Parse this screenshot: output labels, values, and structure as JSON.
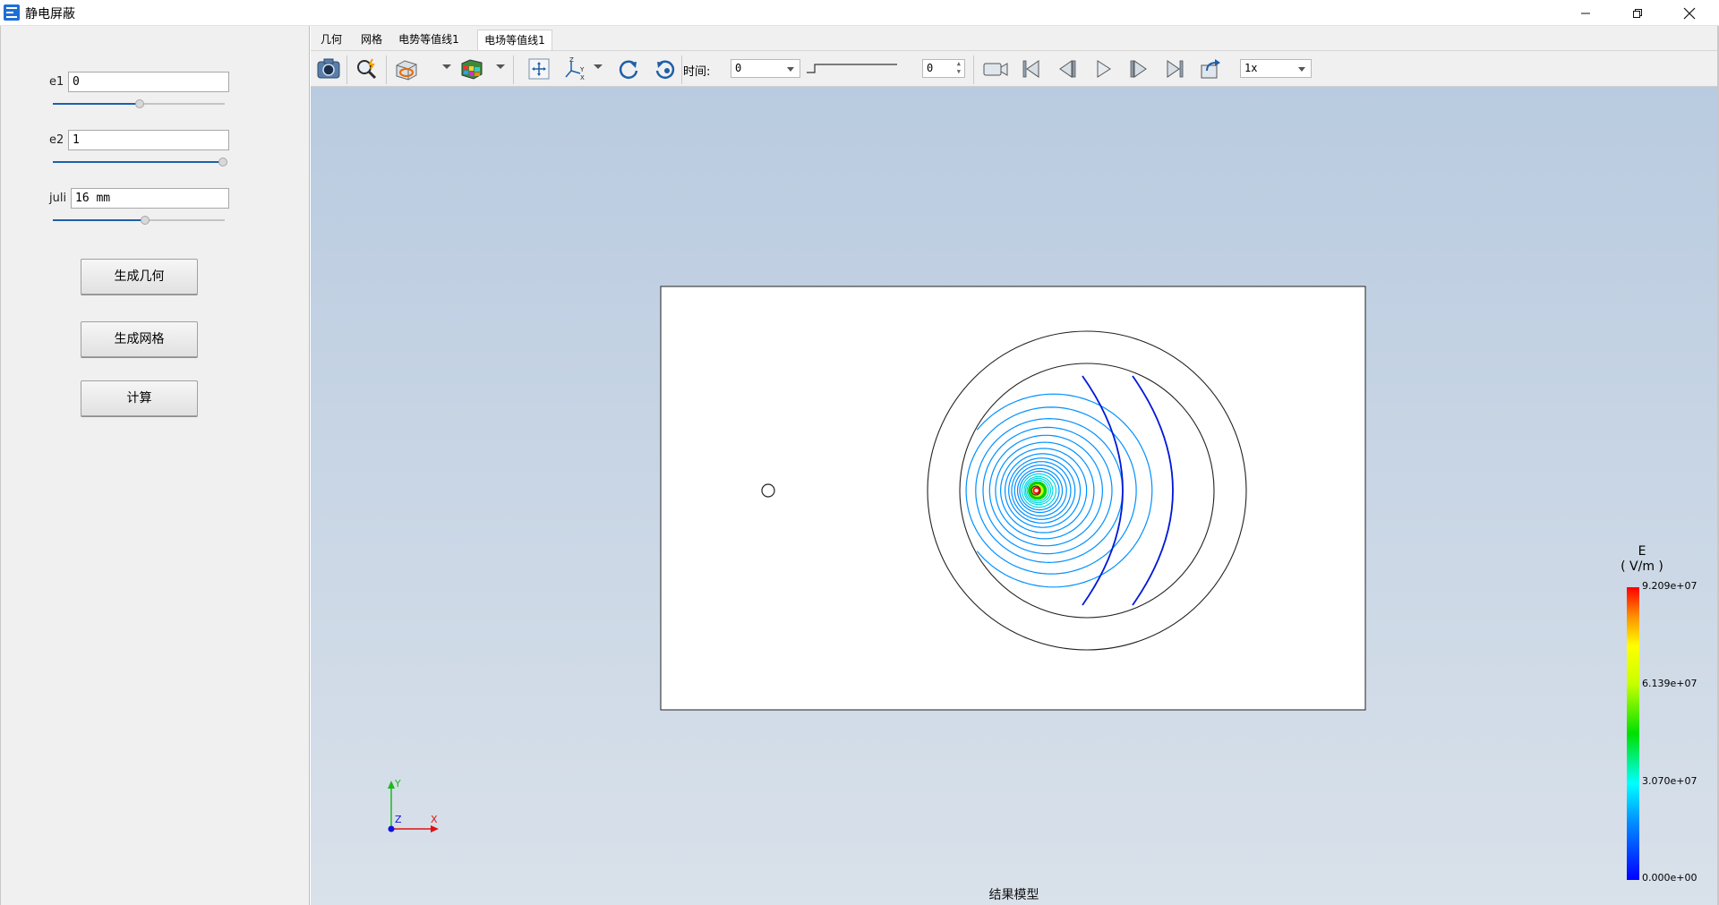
{
  "window": {
    "title": "静电屏蔽",
    "minimize": "minimize-icon",
    "restore": "restore-icon",
    "close": "close-icon"
  },
  "params": [
    {
      "label": "e1",
      "value": "0",
      "slider_fraction": 0.5
    },
    {
      "label": "e2",
      "value": "1",
      "slider_fraction": 1.0
    },
    {
      "label": "juli",
      "value": "16 mm",
      "slider_fraction": 0.53
    }
  ],
  "buttons": {
    "gen_geometry": "生成几何",
    "gen_mesh": "生成网格",
    "compute": "计算"
  },
  "tabs": [
    {
      "label": "几何",
      "active": false
    },
    {
      "label": "网格",
      "active": false
    },
    {
      "label": "电势等值线1",
      "active": false
    },
    {
      "label": "电场等值线1",
      "active": true
    }
  ],
  "toolbar": {
    "icons": [
      "screenshot-icon",
      "zoom-icon",
      "clip-icon",
      "render-mode-icon",
      "fit-view-icon",
      "axis-view-icon",
      "rotate-cw-icon",
      "rotate-ccw-icon"
    ],
    "time_label": "时间:",
    "time_value": "0",
    "step_value": "0",
    "playback_icons": [
      "record-icon",
      "first-frame-icon",
      "prev-frame-icon",
      "play-icon",
      "next-frame-icon",
      "last-frame-icon",
      "export-icon"
    ],
    "speed": "1x"
  },
  "viewport": {
    "caption": "结果模型",
    "triad": {
      "x": "X",
      "y": "Y",
      "z": "Z"
    },
    "colorbar": {
      "title": "E",
      "unit": "( V/m )",
      "max": "9.209e+07",
      "mid_high": "6.139e+07",
      "mid_low": "3.070e+07",
      "min": "0.000e+00"
    }
  },
  "colors": {
    "accent": "#1e5fa8",
    "contour_low": "#0018d8",
    "contour_high": "#ff0000"
  }
}
